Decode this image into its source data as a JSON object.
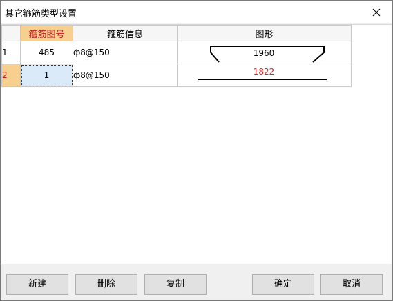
{
  "window": {
    "title": "其它箍筋类型设置"
  },
  "grid": {
    "columns": [
      "箍筋图号",
      "箍筋信息",
      "图形"
    ],
    "rows": [
      {
        "index": "1",
        "figure_no": "485",
        "info": "ф8@150",
        "shape_label": "1960"
      },
      {
        "index": "2",
        "figure_no": "1",
        "info": "ф8@150",
        "shape_label": "1822"
      }
    ]
  },
  "buttons": {
    "new": "新建",
    "delete": "删除",
    "copy": "复制",
    "ok": "确定",
    "cancel": "取消"
  },
  "colors": {
    "header_selected": "#f7cf8f",
    "label_red": "#e02020",
    "current_cell": "#dbeaf8"
  }
}
